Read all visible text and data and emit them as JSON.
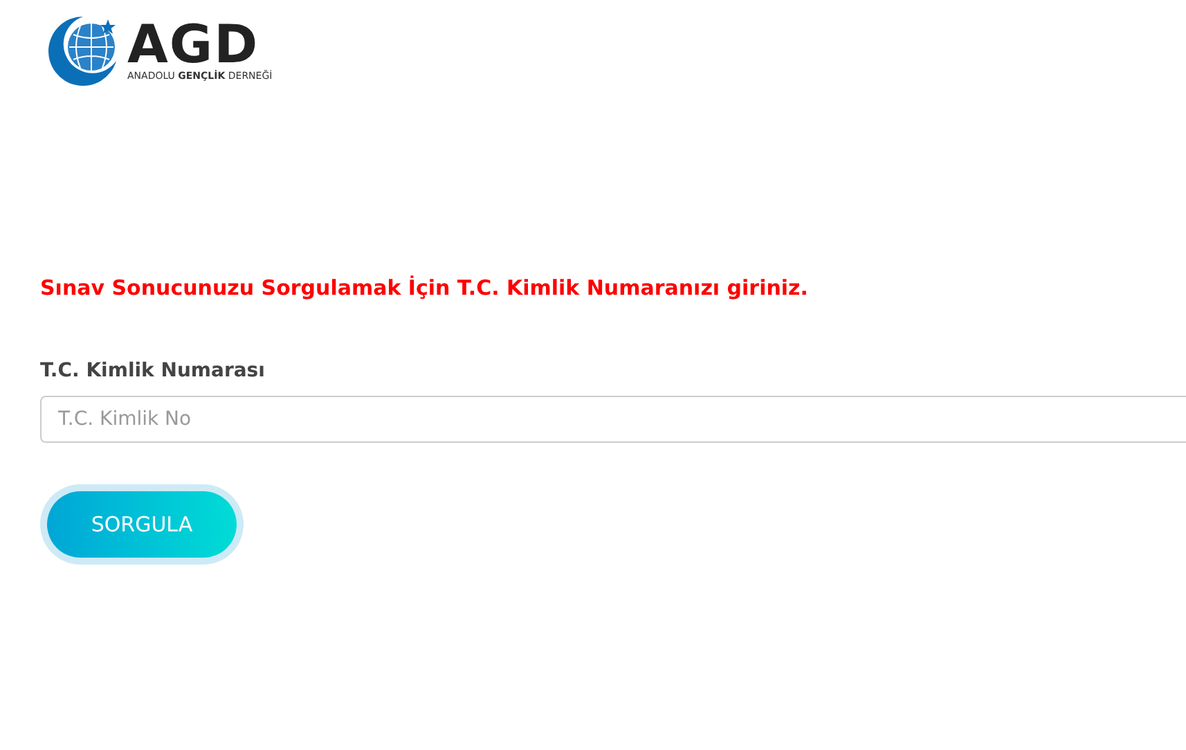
{
  "logo": {
    "mark": "AGD",
    "subtitle_parts": [
      "ANADOLU",
      "GENÇLİK",
      "DERNEĞİ"
    ]
  },
  "message": "Sınav Sonucunuzu Sorgulamak İçin T.C. Kimlik Numaranızı giriniz.",
  "form": {
    "label": "T.C. Kimlik Numarası",
    "placeholder": "T.C. Kimlik No",
    "button": "SORGULA"
  }
}
